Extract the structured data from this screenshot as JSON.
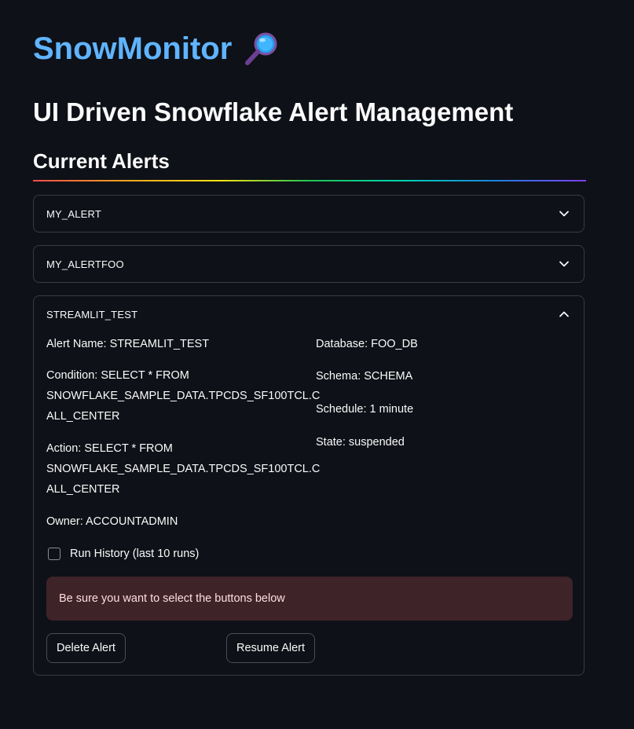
{
  "app": {
    "title": "SnowMonitor",
    "title_emoji": "magnifying-glass",
    "subtitle": "UI Driven Snowflake Alert Management"
  },
  "section": {
    "header": "Current Alerts"
  },
  "alerts": [
    {
      "label": "MY_ALERT",
      "expanded": false
    },
    {
      "label": "MY_ALERTFOO",
      "expanded": false
    },
    {
      "label": "STREAMLIT_TEST",
      "expanded": true,
      "details": {
        "alert_name": "Alert Name: STREAMLIT_TEST",
        "condition_line1": "Condition: SELECT * FROM",
        "condition_line2": "SNOWFLAKE_SAMPLE_DATA.TPCDS_SF100TCL.C",
        "condition_line3": "ALL_CENTER",
        "action_line1": "Action: SELECT * FROM",
        "action_line2": "SNOWFLAKE_SAMPLE_DATA.TPCDS_SF100TCL.C",
        "action_line3": "ALL_CENTER",
        "owner": "Owner: ACCOUNTADMIN",
        "database": "Database: FOO_DB",
        "schema": "Schema: SCHEMA",
        "schedule": "Schedule: 1 minute",
        "state": "State: suspended"
      },
      "run_history_label": "Run History (last 10 runs)",
      "run_history_checked": false,
      "warning": "Be sure you want to select the buttons below",
      "delete_button": "Delete Alert",
      "resume_button": "Resume Alert"
    }
  ],
  "colors": {
    "background": "#0e1117",
    "title": "#60b4ff",
    "border": "#383b44",
    "warning_bg": "#3e2328",
    "warning_text": "#ffdedf"
  }
}
